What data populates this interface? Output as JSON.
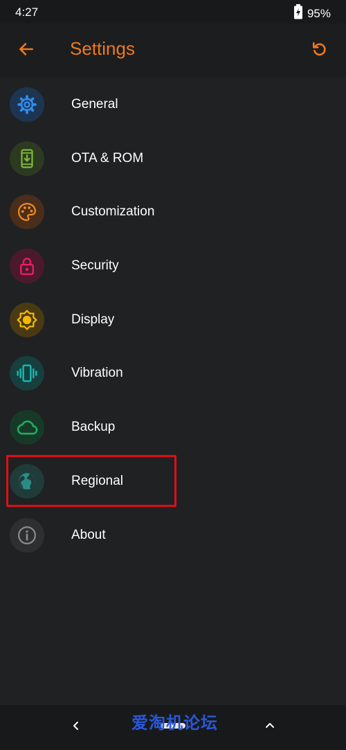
{
  "status_bar": {
    "time": "4:27",
    "battery_percent": "95%"
  },
  "header": {
    "title": "Settings",
    "accent_color": "#ee7a1c",
    "back_icon": "arrow-left-icon",
    "reset_icon": "refresh-icon"
  },
  "menu": {
    "items": [
      {
        "label": "General",
        "icon": "gear-icon",
        "color": "#2d8df0"
      },
      {
        "label": "OTA & ROM",
        "icon": "phone-download-icon",
        "color": "#7eb73a"
      },
      {
        "label": "Customization",
        "icon": "palette-icon",
        "color": "#ef8b1e"
      },
      {
        "label": "Security",
        "icon": "lock-icon",
        "color": "#e91e63"
      },
      {
        "label": "Display",
        "icon": "brightness-icon",
        "color": "#f5b800"
      },
      {
        "label": "Vibration",
        "icon": "vibration-icon",
        "color": "#19b5ae"
      },
      {
        "label": "Backup",
        "icon": "cloud-icon",
        "color": "#1fae5f"
      },
      {
        "label": "Regional",
        "icon": "globe-icon",
        "color": "#2a8d85"
      },
      {
        "label": "About",
        "icon": "info-icon",
        "color": "#8a8a8a"
      }
    ]
  },
  "highlight": {
    "color": "#e10d16"
  },
  "watermark": {
    "text": "爱淘机论坛"
  }
}
